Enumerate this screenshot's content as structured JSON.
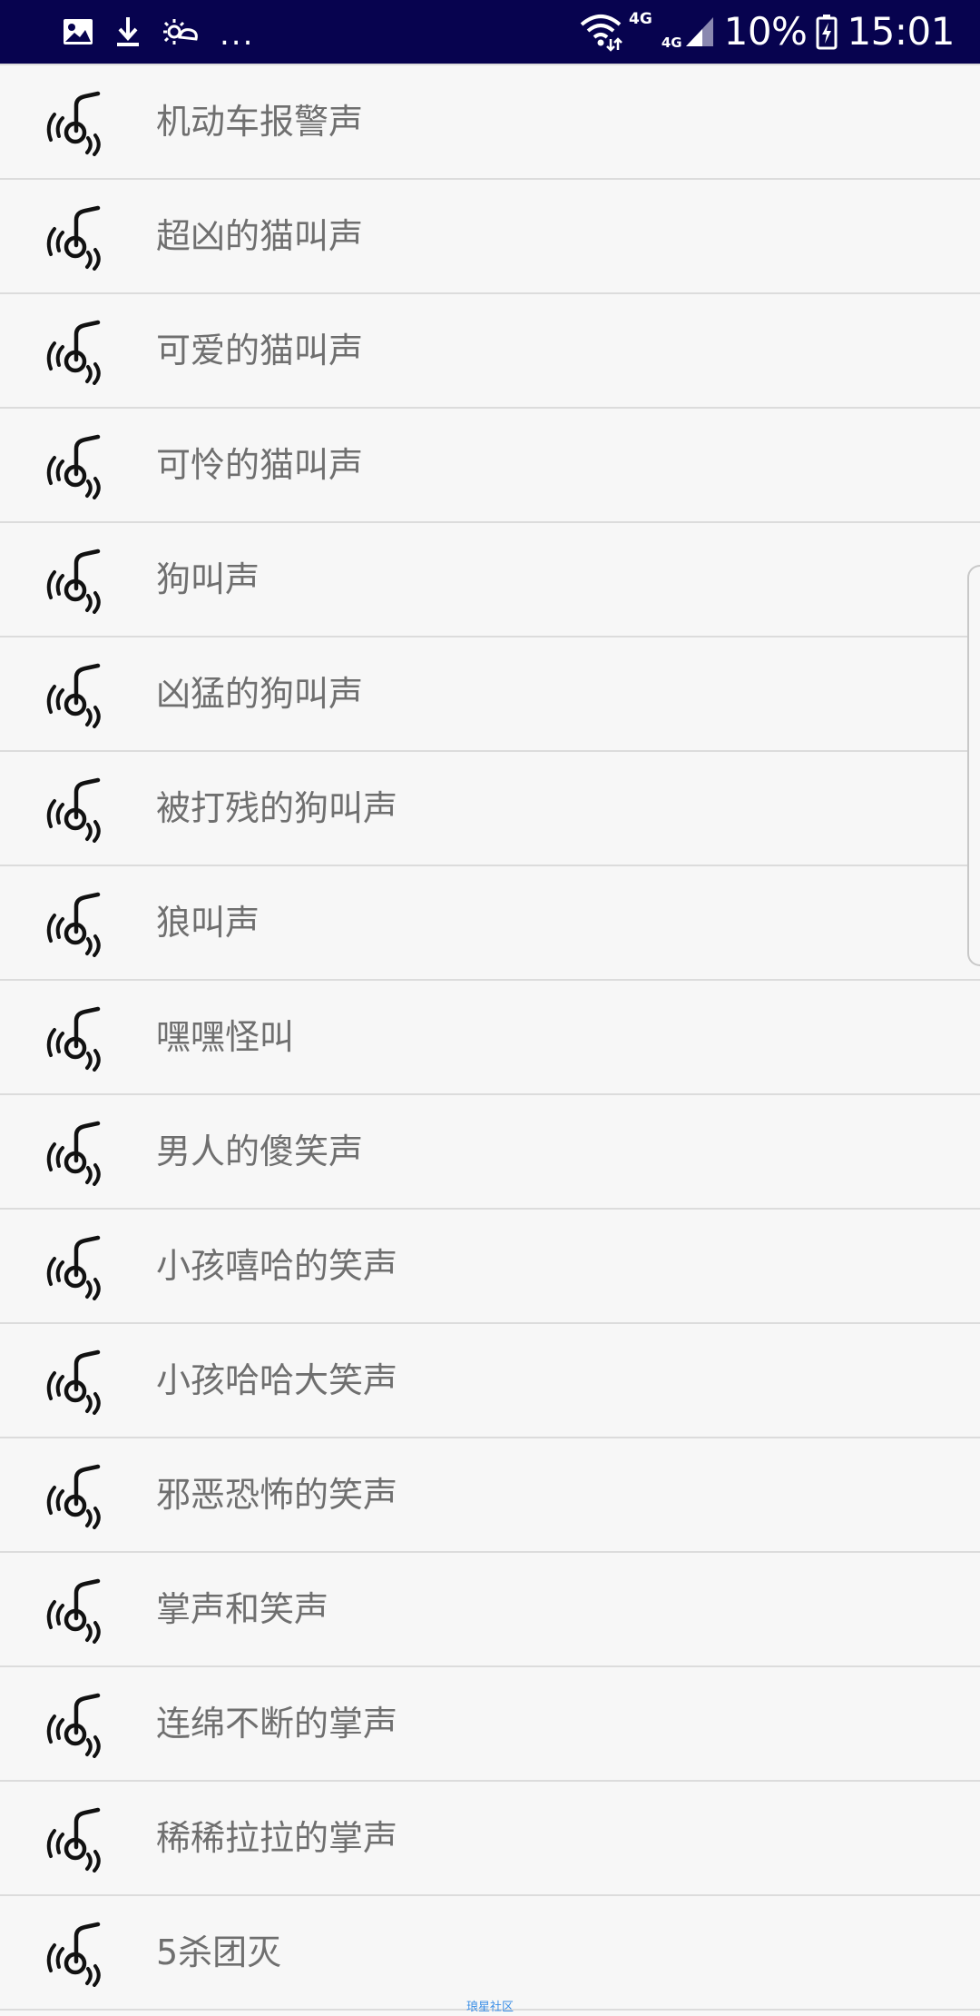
{
  "status_bar": {
    "dots": "...",
    "net_4g": "4G",
    "net_4g_small": "4G",
    "battery_pct": "10%",
    "time": "15:01",
    "bg_color": "#07034f"
  },
  "list": {
    "item_icon": "sound-note-icon",
    "items": [
      {
        "label": "机动车报警声"
      },
      {
        "label": "超凶的猫叫声"
      },
      {
        "label": "可爱的猫叫声"
      },
      {
        "label": "可怜的猫叫声"
      },
      {
        "label": "狗叫声"
      },
      {
        "label": "凶猛的狗叫声"
      },
      {
        "label": "被打残的狗叫声"
      },
      {
        "label": "狼叫声"
      },
      {
        "label": "嘿嘿怪叫"
      },
      {
        "label": "男人的傻笑声"
      },
      {
        "label": "小孩嘻哈的笑声"
      },
      {
        "label": "小孩哈哈大笑声"
      },
      {
        "label": "邪恶恐怖的笑声"
      },
      {
        "label": "掌声和笑声"
      },
      {
        "label": "连绵不断的掌声"
      },
      {
        "label": "稀稀拉拉的掌声"
      },
      {
        "label": "5杀团灭"
      }
    ]
  },
  "watermark": "琅星社区"
}
